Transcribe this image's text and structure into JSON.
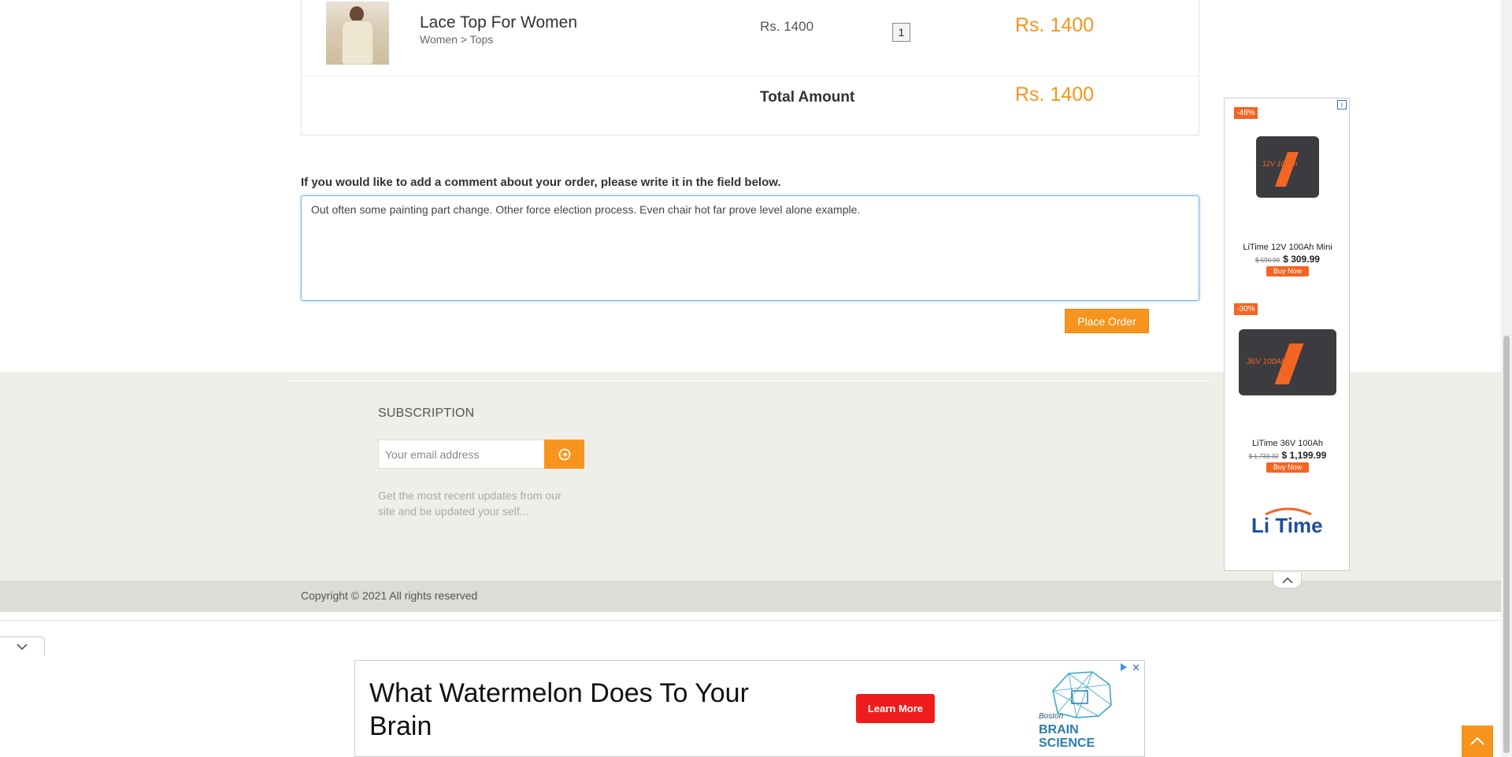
{
  "cart": {
    "item": {
      "name": "Lace Top For Women",
      "category": "Women > Tops",
      "price": "Rs. 1400",
      "quantity": "1",
      "subtotal": "Rs. 1400"
    },
    "total_label": "Total Amount",
    "total_value": "Rs. 1400"
  },
  "comment": {
    "label": "If you would like to add a comment about your order, please write it in the field below.",
    "value": "Out often some painting part change. Other force election process. Even chair hot far prove level alone example."
  },
  "place_order_label": "Place Order",
  "footer": {
    "subscription_title": "SUBSCRIPTION",
    "email_placeholder": "Your email address",
    "description": "Get the most recent updates from our site and be updated your self...",
    "copyright": "Copyright © 2021 All rights reserved"
  },
  "side_ad": {
    "items": [
      {
        "discount": "-48%",
        "name": "LiTime 12V 100Ah Mini",
        "old_price": "$ 599.99",
        "new_price": "$ 309.99",
        "cta": "Buy Now",
        "badge": "12V 100Ah"
      },
      {
        "discount": "-30%",
        "name": "LiTime 36V 100Ah",
        "old_price": "$ 1,733.32",
        "new_price": "$ 1,199.99",
        "cta": "Buy Now",
        "badge": "36V 100Ah"
      }
    ],
    "brand": "Li Time",
    "info_icon": "i"
  },
  "bottom_ad": {
    "title": "What Watermelon Does To Your Brain",
    "cta": "Learn More",
    "brand_small": "Boston",
    "brand_line1": "BRAIN",
    "brand_line2": "SCIENCE"
  },
  "colors": {
    "accent": "#f7941d",
    "ad_accent": "#f26522",
    "ad_cta": "#ee1c1c"
  }
}
